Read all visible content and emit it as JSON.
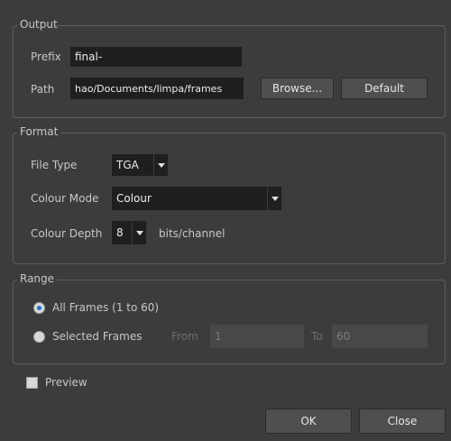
{
  "output": {
    "title": "Output",
    "prefix_label": "Prefix",
    "prefix_value": "final-",
    "path_label": "Path",
    "path_value": "hao/Documents/limpa/frames",
    "browse_label": "Browse...",
    "default_label": "Default"
  },
  "format": {
    "title": "Format",
    "file_type_label": "File Type",
    "file_type_value": "TGA",
    "colour_mode_label": "Colour Mode",
    "colour_mode_value": "Colour",
    "colour_depth_label": "Colour Depth",
    "colour_depth_value": "8",
    "colour_depth_unit": "bits/channel"
  },
  "range": {
    "title": "Range",
    "all_frames_label": "All Frames (1 to 60)",
    "all_frames_selected": true,
    "selected_frames_label": "Selected Frames",
    "from_label": "From",
    "from_value": "1",
    "to_label": "To",
    "to_value": "60"
  },
  "preview": {
    "label": "Preview",
    "checked": false
  },
  "footer": {
    "ok_label": "OK",
    "close_label": "Close"
  }
}
